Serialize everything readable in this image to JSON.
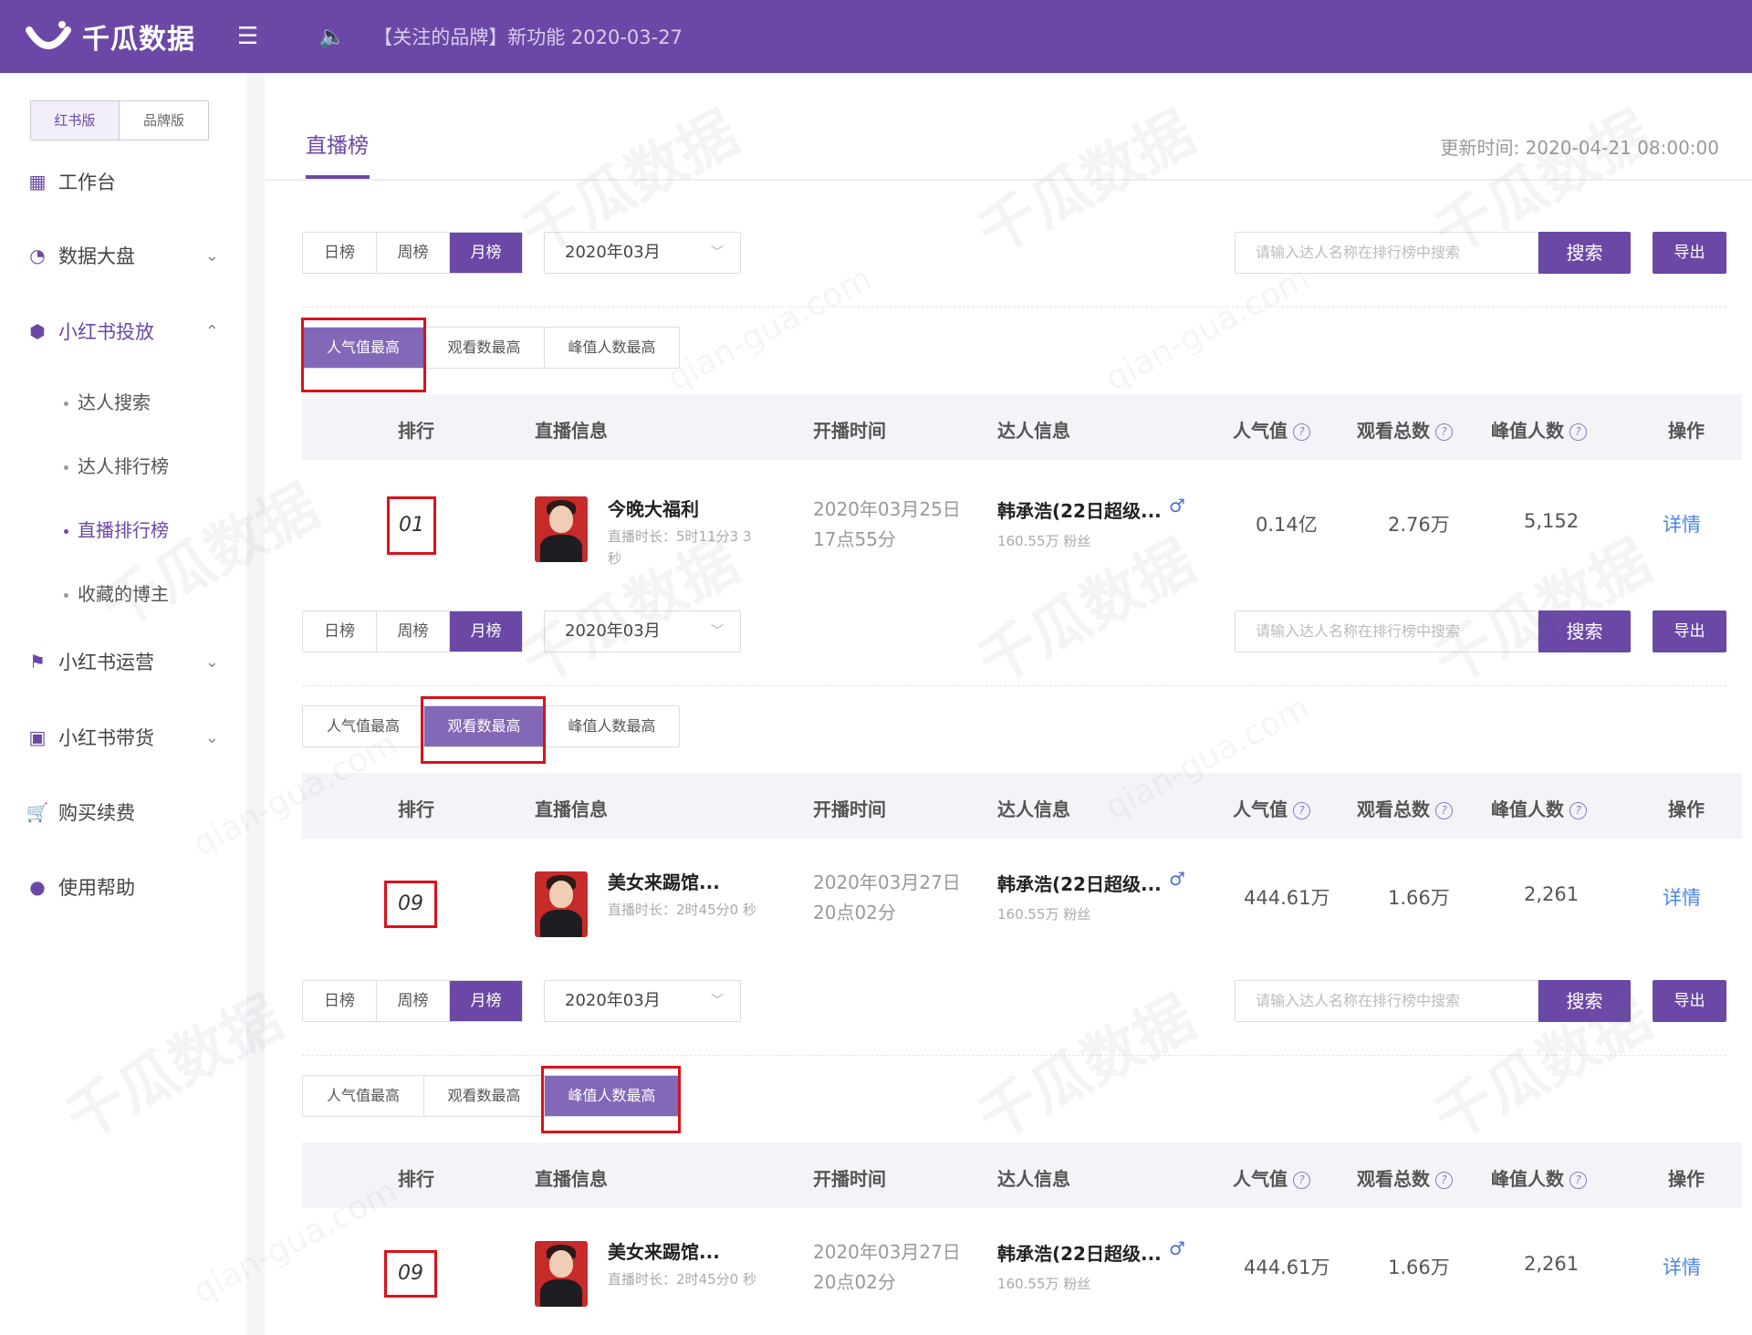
{
  "app": {
    "name": "千瓜数据",
    "notice": "【关注的品牌】新功能  2020-03-27"
  },
  "sidebar": {
    "editions": [
      "红书版",
      "品牌版"
    ],
    "nav": [
      {
        "label": "工作台"
      },
      {
        "label": "数据大盘"
      },
      {
        "label": "小红书投放"
      },
      {
        "label": "小红书运营"
      },
      {
        "label": "小红书带货"
      },
      {
        "label": "购买续费"
      },
      {
        "label": "使用帮助"
      }
    ],
    "sub": [
      "达人搜索",
      "达人排行榜",
      "直播排行榜",
      "收藏的博主"
    ]
  },
  "page": {
    "title": "直播榜",
    "update_time": "更新时间: 2020-04-21 08:00:00"
  },
  "toolbar": {
    "periods": [
      "日榜",
      "周榜",
      "月榜"
    ],
    "month": "2020年03月",
    "search_placeholder": "请输入达人名称在排行榜中搜索",
    "search_label": "搜索",
    "export_label": "导出"
  },
  "sort_tabs": [
    "人气值最高",
    "观看数最高",
    "峰值人数最高"
  ],
  "table_headers": [
    "排行",
    "直播信息",
    "开播时间",
    "达人信息",
    "人气值",
    "观看总数",
    "峰值人数",
    "操作"
  ],
  "blocks": [
    {
      "active_sort": 0,
      "row": {
        "rank": "01",
        "title": "今晚大福利",
        "duration": "直播时长：5时11分3 3秒",
        "start_line1": "2020年03月25日",
        "start_line2": "17点55分",
        "kol": "韩承浩(22日超级...",
        "fans": "160.55万 粉丝",
        "popularity": "0.14亿",
        "views": "2.76万",
        "peak": "5,152",
        "action": "详情"
      }
    },
    {
      "active_sort": 1,
      "row": {
        "rank": "09",
        "title": "美女来踢馆...",
        "duration": "直播时长：2时45分0 秒",
        "start_line1": "2020年03月27日",
        "start_line2": "20点02分",
        "kol": "韩承浩(22日超级...",
        "fans": "160.55万 粉丝",
        "popularity": "444.61万",
        "views": "1.66万",
        "peak": "2,261",
        "action": "详情"
      }
    },
    {
      "active_sort": 2,
      "row": {
        "rank": "09",
        "title": "美女来踢馆...",
        "duration": "直播时长：2时45分0 秒",
        "start_line1": "2020年03月27日",
        "start_line2": "20点02分",
        "kol": "韩承浩(22日超级...",
        "fans": "160.55万 粉丝",
        "popularity": "444.61万",
        "views": "1.66万",
        "peak": "2,261",
        "action": "详情"
      }
    }
  ],
  "colors": {
    "brand": "#6b48a6",
    "highlight": "#d9121a",
    "link": "#4a86e8"
  },
  "watermark": {
    "cn": "千瓜数据",
    "en": "qian-gua.com"
  }
}
